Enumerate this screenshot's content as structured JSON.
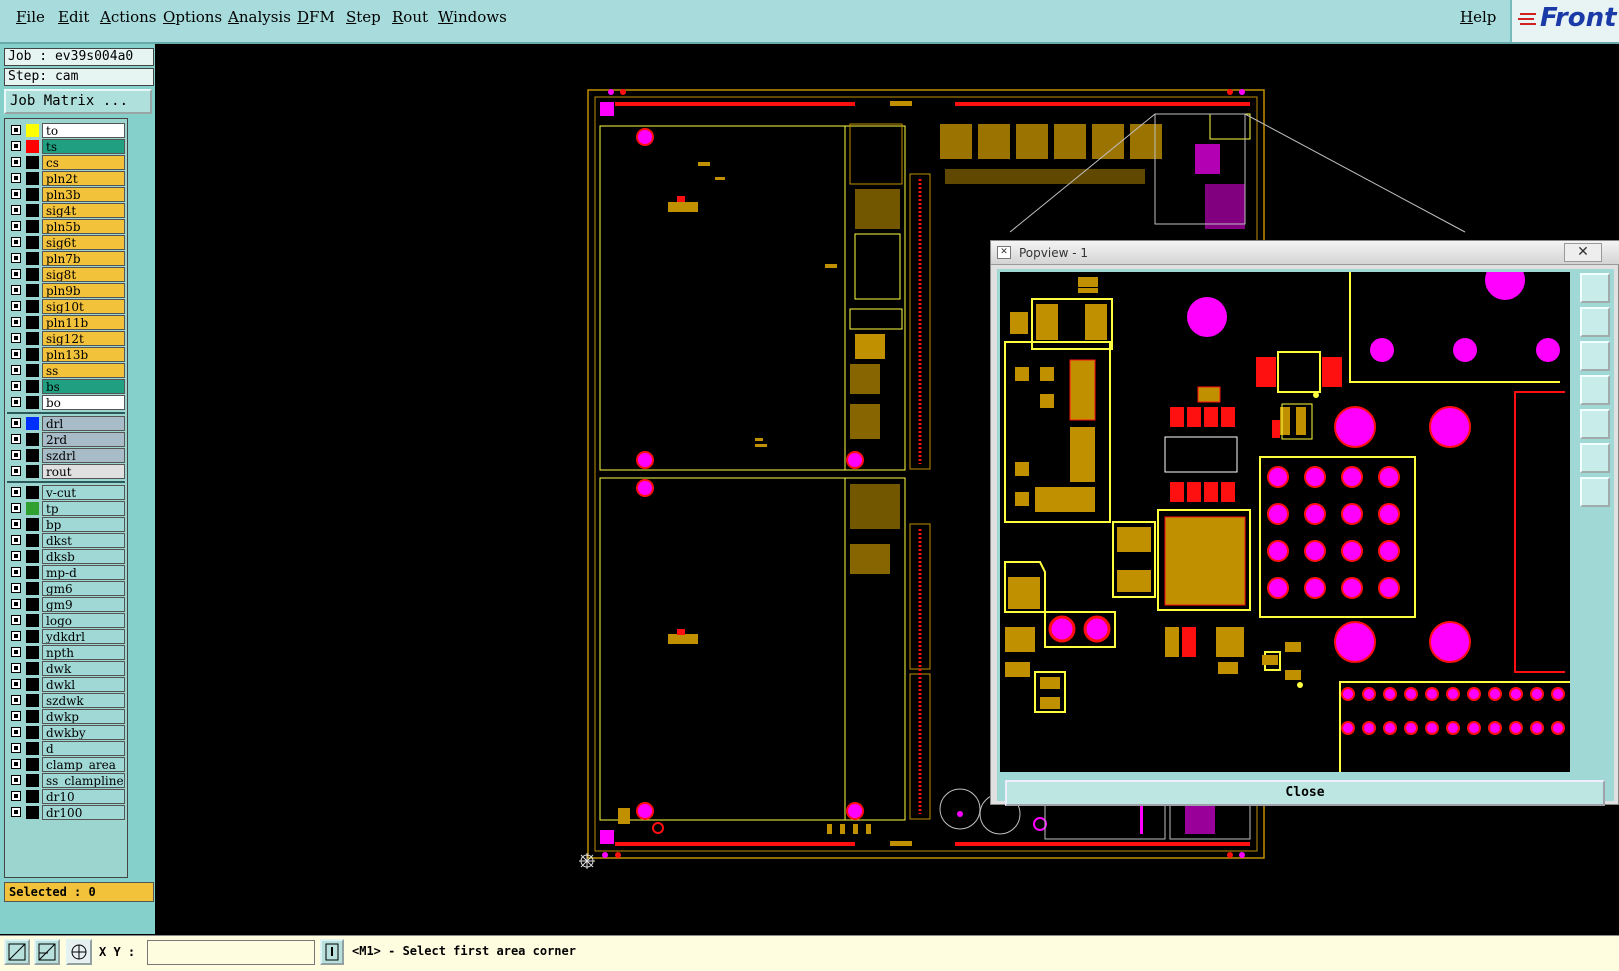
{
  "menu": {
    "items": [
      "File",
      "Edit",
      "Actions",
      "Options",
      "Analysis",
      "DFM",
      "Step",
      "Rout",
      "Windows"
    ],
    "help": "Help",
    "logo": "Front"
  },
  "job": {
    "job_label": "Job : ev39s004a0",
    "step_label": "Step: cam",
    "matrix_button": "Job Matrix ..."
  },
  "layers": {
    "group1": [
      {
        "name": "to",
        "color": "#ffff00",
        "bg": "#ffffff"
      },
      {
        "name": "ts",
        "color": "#ff0000",
        "bg": "#20a080"
      },
      {
        "name": "cs",
        "color": "#000000",
        "bg": "#f2c23a"
      },
      {
        "name": "pln2t",
        "color": "#000000",
        "bg": "#f2c23a"
      },
      {
        "name": "pln3b",
        "color": "#000000",
        "bg": "#f2c23a"
      },
      {
        "name": "sig4t",
        "color": "#000000",
        "bg": "#f2c23a"
      },
      {
        "name": "pln5b",
        "color": "#000000",
        "bg": "#f2c23a"
      },
      {
        "name": "sig6t",
        "color": "#000000",
        "bg": "#f2c23a"
      },
      {
        "name": "pln7b",
        "color": "#000000",
        "bg": "#f2c23a"
      },
      {
        "name": "sig8t",
        "color": "#000000",
        "bg": "#f2c23a"
      },
      {
        "name": "pln9b",
        "color": "#000000",
        "bg": "#f2c23a"
      },
      {
        "name": "sig10t",
        "color": "#000000",
        "bg": "#f2c23a"
      },
      {
        "name": "pln11b",
        "color": "#000000",
        "bg": "#f2c23a"
      },
      {
        "name": "sig12t",
        "color": "#000000",
        "bg": "#f2c23a"
      },
      {
        "name": "pln13b",
        "color": "#000000",
        "bg": "#f2c23a"
      },
      {
        "name": "ss",
        "color": "#000000",
        "bg": "#f2c23a"
      },
      {
        "name": "bs",
        "color": "#000000",
        "bg": "#20a080"
      },
      {
        "name": "bo",
        "color": "#000000",
        "bg": "#ffffff"
      }
    ],
    "group2": [
      {
        "name": "drl",
        "color": "#0030ff",
        "bg": "#a8bcc8"
      },
      {
        "name": "2rd",
        "color": "#000000",
        "bg": "#a8bcc8"
      },
      {
        "name": "szdrl",
        "color": "#000000",
        "bg": "#a8bcc8"
      },
      {
        "name": "rout",
        "color": "#000000",
        "bg": "#e0e0e0"
      }
    ],
    "group3": [
      {
        "name": "v-cut",
        "color": "#000000",
        "bg": "#9fd8d4"
      },
      {
        "name": "tp",
        "color": "#30a030",
        "bg": "#9fd8d4"
      },
      {
        "name": "bp",
        "color": "#000000",
        "bg": "#9fd8d4"
      },
      {
        "name": "dkst",
        "color": "#000000",
        "bg": "#9fd8d4"
      },
      {
        "name": "dksb",
        "color": "#000000",
        "bg": "#9fd8d4"
      },
      {
        "name": "mp-d",
        "color": "#000000",
        "bg": "#9fd8d4"
      },
      {
        "name": "gm6",
        "color": "#000000",
        "bg": "#9fd8d4"
      },
      {
        "name": "gm9",
        "color": "#000000",
        "bg": "#9fd8d4"
      },
      {
        "name": "logo",
        "color": "#000000",
        "bg": "#9fd8d4"
      },
      {
        "name": "ydkdrl",
        "color": "#000000",
        "bg": "#9fd8d4"
      },
      {
        "name": "npth",
        "color": "#000000",
        "bg": "#9fd8d4"
      },
      {
        "name": "dwk",
        "color": "#000000",
        "bg": "#9fd8d4"
      },
      {
        "name": "dwkl",
        "color": "#000000",
        "bg": "#9fd8d4"
      },
      {
        "name": "szdwk",
        "color": "#000000",
        "bg": "#9fd8d4"
      },
      {
        "name": "dwkp",
        "color": "#000000",
        "bg": "#9fd8d4"
      },
      {
        "name": "dwkby",
        "color": "#000000",
        "bg": "#9fd8d4"
      },
      {
        "name": "d",
        "color": "#000000",
        "bg": "#9fd8d4"
      },
      {
        "name": "clamp_area",
        "color": "#000000",
        "bg": "#9fd8d4"
      },
      {
        "name": "ss_clampline",
        "color": "#000000",
        "bg": "#9fd8d4"
      },
      {
        "name": "dr10",
        "color": "#000000",
        "bg": "#9fd8d4"
      },
      {
        "name": "dr100",
        "color": "#000000",
        "bg": "#9fd8d4"
      }
    ]
  },
  "selected": "Selected : 0",
  "status": {
    "xy_label": "X Y :",
    "xy_value": "",
    "message": "<M1> - Select first area corner"
  },
  "popview": {
    "title": "Popview - 1",
    "close_x": "✕",
    "close_button": "Close"
  },
  "colors": {
    "pad_magenta": "#ff00ff",
    "copper_gold": "#c09000",
    "outline_yellow": "#ffff40",
    "trace_red": "#ff1010",
    "panel_teal": "#86d0cc"
  }
}
